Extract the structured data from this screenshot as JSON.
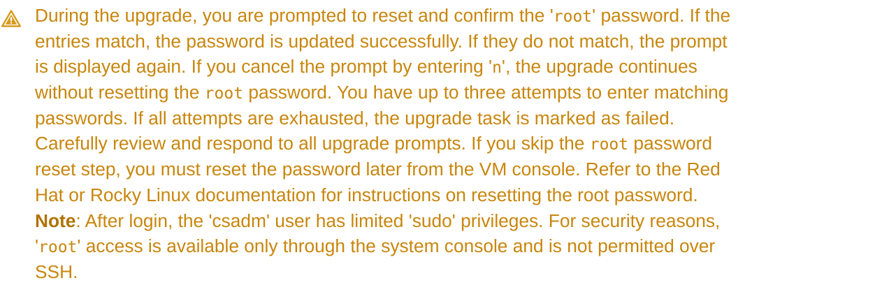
{
  "callout": {
    "icon": "warning-triangle-icon",
    "text_color": "#c8860d",
    "icon_color": "#d69a1f",
    "lines": [
      [
        "During the upgrade, you are prompted to reset and confirm the '",
        {
          "code": "root"
        },
        "' password. If the"
      ],
      [
        "entries match, the password is updated successfully. If they do not match, the prompt"
      ],
      [
        "is displayed again. If you cancel the prompt by entering '",
        {
          "code": "n"
        },
        "', the upgrade continues"
      ],
      [
        "without resetting the ",
        {
          "code": "root"
        },
        " password. You have up to three attempts to enter matching"
      ],
      [
        "passwords. If all attempts are exhausted, the upgrade task is marked as failed."
      ],
      [
        "Carefully review and respond to all upgrade prompts. If you skip the ",
        {
          "code": "root"
        },
        " password"
      ],
      [
        "reset step, you must reset the password later from the VM console. Refer to the Red"
      ],
      [
        "Hat or Rocky Linux documentation for instructions on resetting the root password."
      ],
      [
        {
          "label": "Note"
        },
        ": After login, the 'csadm' user has limited 'sudo' privileges. For security reasons,"
      ],
      [
        "'",
        {
          "code": "root"
        },
        "' access is available only through the system console and is not permitted over"
      ],
      [
        "SSH."
      ]
    ]
  }
}
